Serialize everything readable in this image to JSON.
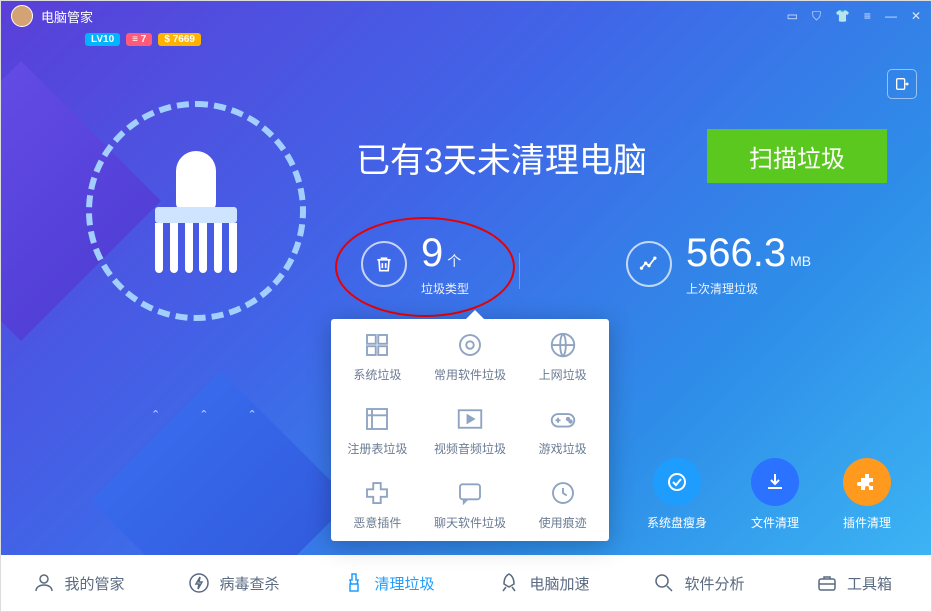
{
  "titlebar": {
    "title": "电脑管家",
    "badges": [
      "LV10",
      "≡ 7",
      "$ 7669"
    ]
  },
  "main": {
    "headline": "已有3天未清理电脑",
    "scanButton": "扫描垃圾",
    "stats": [
      {
        "value": "9",
        "unit": "个",
        "label": "垃圾类型"
      },
      {
        "value": "566.3",
        "unit": "MB",
        "label": "上次清理垃圾"
      }
    ]
  },
  "popup": {
    "items": [
      "系统垃圾",
      "常用软件垃圾",
      "上网垃圾",
      "注册表垃圾",
      "视频音频垃圾",
      "游戏垃圾",
      "恶意插件",
      "聊天软件垃圾",
      "使用痕迹"
    ]
  },
  "shortcuts": [
    "系统盘瘦身",
    "文件清理",
    "插件清理"
  ],
  "nav": [
    "我的管家",
    "病毒查杀",
    "清理垃圾",
    "电脑加速",
    "软件分析",
    "工具箱"
  ],
  "colors": {
    "accent": "#1e9dff",
    "scan": "#5ac81e",
    "annotation": "#e80000"
  }
}
